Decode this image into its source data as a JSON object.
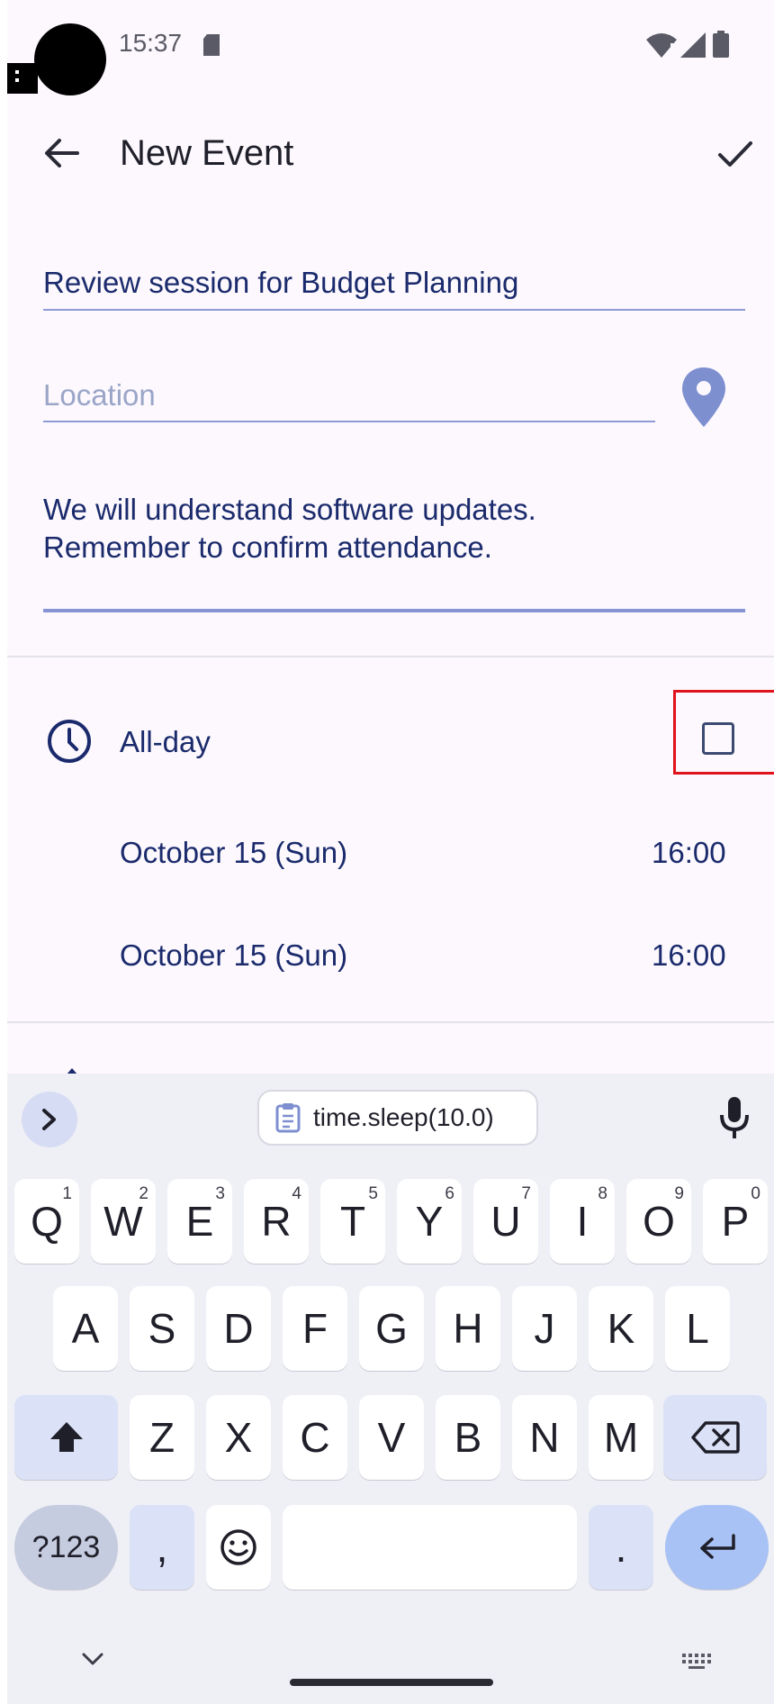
{
  "status_bar": {
    "time": "15:37"
  },
  "toolbar": {
    "title": "New Event",
    "back_icon": "arrow-back-icon",
    "confirm_icon": "check-icon"
  },
  "form": {
    "title_value": "Review session for Budget Planning",
    "location_placeholder": "Location",
    "location_icon": "map-pin-icon",
    "description_value": "We will understand software updates.\nRemember to confirm attendance.",
    "all_day_label": "All-day",
    "all_day_checked": false,
    "start_date": "October 15 (Sun)",
    "start_time": "16:00",
    "end_date": "October 15 (Sun)",
    "end_time": "16:00"
  },
  "keyboard": {
    "clipboard_suggestion": "time.sleep(10.0)",
    "row1": [
      {
        "key": "Q",
        "hint": "1"
      },
      {
        "key": "W",
        "hint": "2"
      },
      {
        "key": "E",
        "hint": "3"
      },
      {
        "key": "R",
        "hint": "4"
      },
      {
        "key": "T",
        "hint": "5"
      },
      {
        "key": "Y",
        "hint": "6"
      },
      {
        "key": "U",
        "hint": "7"
      },
      {
        "key": "I",
        "hint": "8"
      },
      {
        "key": "O",
        "hint": "9"
      },
      {
        "key": "P",
        "hint": "0"
      }
    ],
    "row2": [
      "A",
      "S",
      "D",
      "F",
      "G",
      "H",
      "J",
      "K",
      "L"
    ],
    "row3": [
      "Z",
      "X",
      "C",
      "V",
      "B",
      "N",
      "M"
    ],
    "symbols_label": "?123",
    "comma_label": ",",
    "period_label": "."
  },
  "colors": {
    "accent": "#8694d6",
    "text": "#1a2a6c",
    "highlight_box": "#e0121c",
    "enter_key": "#a9c2f5"
  }
}
